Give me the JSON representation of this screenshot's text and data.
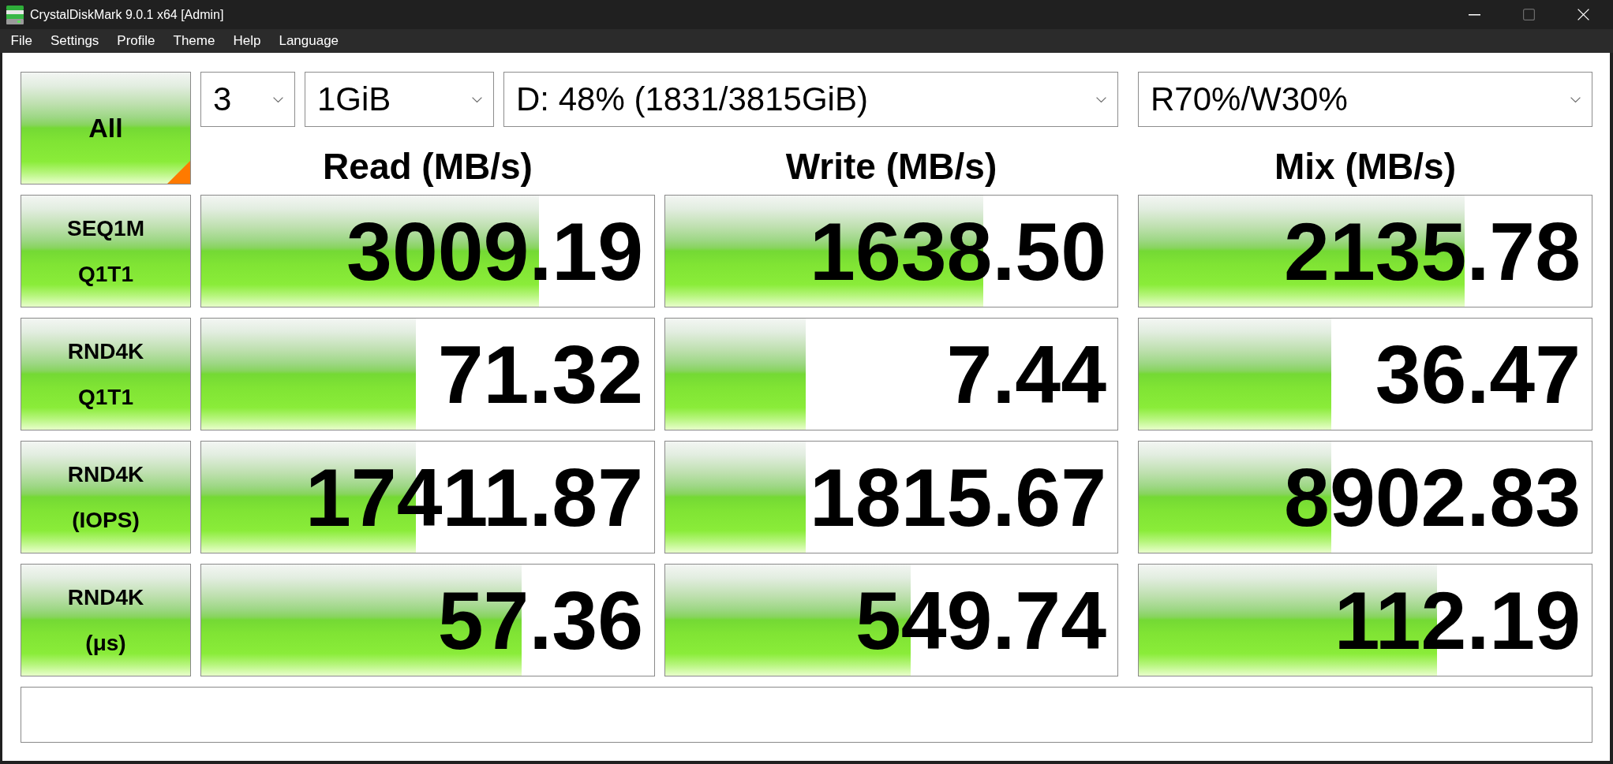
{
  "window": {
    "title": "CrystalDiskMark 9.0.1 x64 [Admin]",
    "maximize_enabled": false
  },
  "menu": [
    "File",
    "Settings",
    "Profile",
    "Theme",
    "Help",
    "Language"
  ],
  "all_button": {
    "label": "All"
  },
  "dropdowns": [
    {
      "value": "3"
    },
    {
      "value": "1GiB"
    },
    {
      "value": "D: 48% (1831/3815GiB)"
    },
    {
      "value": "R70%/W30%"
    }
  ],
  "results": {
    "columns": [
      "Read (MB/s)",
      "Write (MB/s)",
      "Mix (MB/s)"
    ],
    "rows": [
      {
        "label_lines": [
          "SEQ1M",
          "Q1T1"
        ],
        "cells": [
          {
            "value": "3009.19",
            "level": 0.745
          },
          {
            "value": "1638.50",
            "level": 0.703
          },
          {
            "value": "2135.78",
            "level": 0.719
          }
        ]
      },
      {
        "label_lines": [
          "RND4K",
          "Q1T1"
        ],
        "cells": [
          {
            "value": "71.32",
            "level": 0.474
          },
          {
            "value": "7.44",
            "level": 0.311
          },
          {
            "value": "36.47",
            "level": 0.425
          }
        ]
      },
      {
        "label_lines": [
          "RND4K",
          "(IOPS)"
        ],
        "cells": [
          {
            "value": "17411.87",
            "level": 0.474
          },
          {
            "value": "1815.67",
            "level": 0.311
          },
          {
            "value": "8902.83",
            "level": 0.425
          }
        ]
      },
      {
        "label_lines": [
          "RND4K",
          "(μs)"
        ],
        "cells": [
          {
            "value": "57.36",
            "level": 0.707
          },
          {
            "value": "549.74",
            "level": 0.543
          },
          {
            "value": "112.19",
            "level": 0.658
          }
        ]
      }
    ]
  }
}
